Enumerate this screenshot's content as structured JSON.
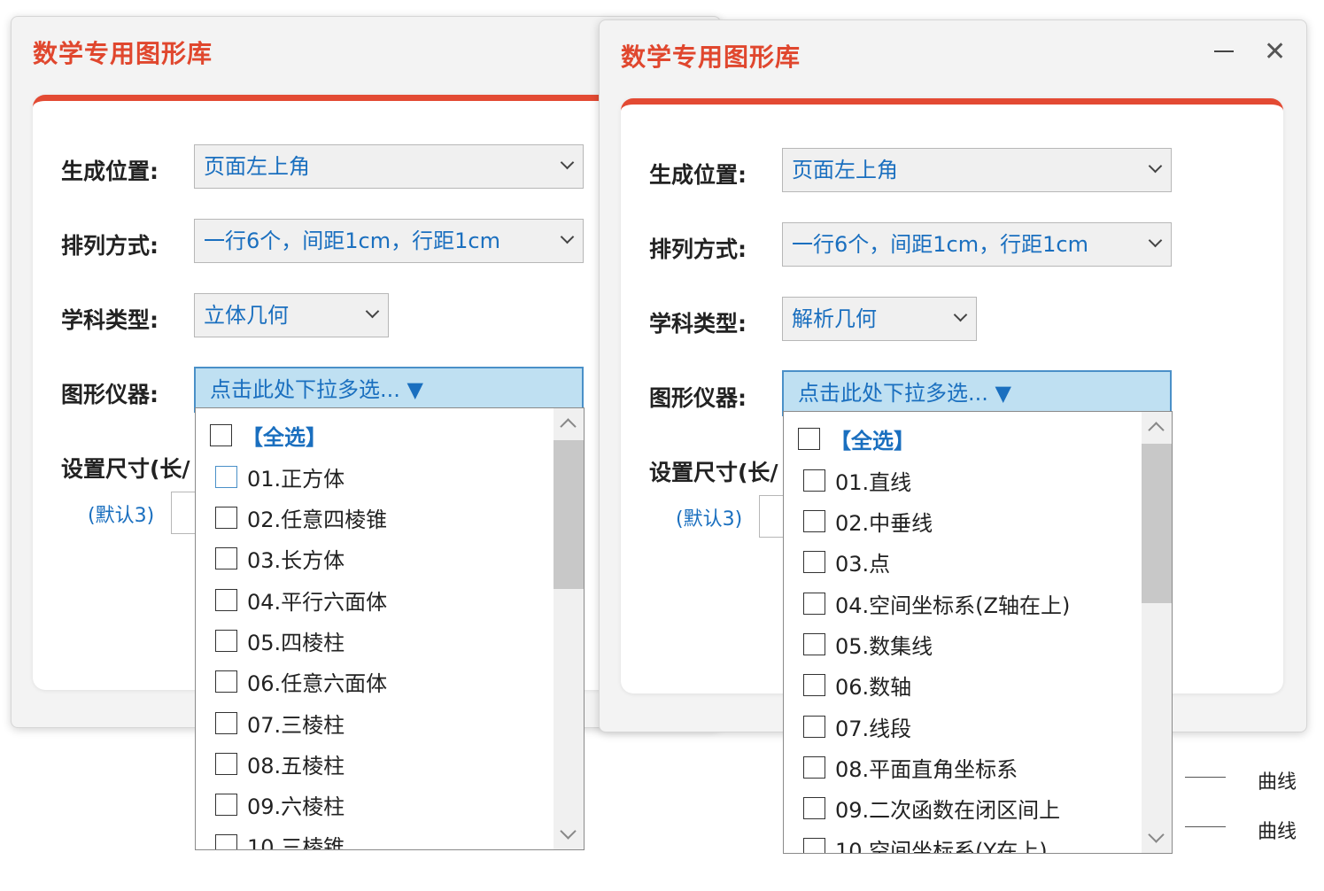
{
  "title": "数学专用图形库",
  "labels": {
    "position": "生成位置:",
    "arrangement": "排列方式:",
    "subject": "学科类型:",
    "instruments": "图形仪器:",
    "size": "设置尺寸(长/",
    "default_note": "(默认3)"
  },
  "window_controls": {
    "minimize": "—",
    "close": "✕"
  },
  "left": {
    "position_value": "页面左上角",
    "arrangement_value": "一行6个，间距1cm，行距1cm",
    "subject_value": "立体几何",
    "multi_placeholder": "点击此处下拉多选... ▼",
    "items": [
      "【全选】",
      "01.正方体",
      "02.任意四棱锥",
      "03.长方体",
      "04.平行六面体",
      "05.四棱柱",
      "06.任意六面体",
      "07.三棱柱",
      "08.五棱柱",
      "09.六棱柱",
      "10.三棱锥"
    ]
  },
  "right": {
    "position_value": "页面左上角",
    "arrangement_value": "一行6个，间距1cm，行距1cm",
    "subject_value": "解析几何",
    "multi_placeholder": "点击此处下拉多选... ▼",
    "items": [
      "【全选】",
      "01.直线",
      "02.中垂线",
      "03.点",
      "04.空间坐标系(Z轴在上)",
      "05.数集线",
      "06.数轴",
      "07.线段",
      "08.平面直角坐标系",
      "09.二次函数在闭区间上",
      "10.空间坐标系(Y在上)"
    ]
  },
  "background": {
    "curve_label_1": "曲线",
    "curve_label_2": "曲线"
  }
}
